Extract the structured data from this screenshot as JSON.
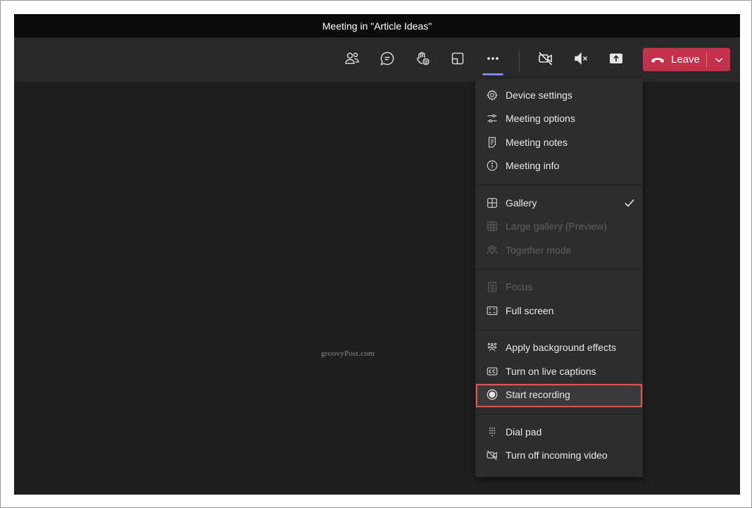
{
  "window": {
    "title": "Meeting in \"Article Ideas\""
  },
  "toolbar": {
    "buttons": [
      {
        "icon": "people-icon"
      },
      {
        "icon": "chat-icon"
      },
      {
        "icon": "reactions-icon"
      },
      {
        "icon": "rooms-icon"
      },
      {
        "icon": "more-options-icon"
      },
      {
        "icon": "camera-off-icon"
      },
      {
        "icon": "mic-mute-icon"
      },
      {
        "icon": "share-screen-icon"
      }
    ],
    "leave_label": "Leave",
    "leave_color": "#c4314b"
  },
  "stage": {
    "watermark": "groovyPost.com"
  },
  "menu": {
    "sections": [
      {
        "items": [
          {
            "label": "Device settings",
            "icon": "gear-icon",
            "enabled": true
          },
          {
            "label": "Meeting options",
            "icon": "sliders-icon",
            "enabled": true
          },
          {
            "label": "Meeting notes",
            "icon": "notes-icon",
            "enabled": true
          },
          {
            "label": "Meeting info",
            "icon": "info-icon",
            "enabled": true
          }
        ]
      },
      {
        "items": [
          {
            "label": "Gallery",
            "icon": "gallery-icon",
            "enabled": true,
            "checked": true
          },
          {
            "label": "Large gallery (Preview)",
            "icon": "large-gallery-icon",
            "enabled": false
          },
          {
            "label": "Together mode",
            "icon": "together-mode-icon",
            "enabled": false
          }
        ]
      },
      {
        "items": [
          {
            "label": "Focus",
            "icon": "focus-icon",
            "enabled": false
          },
          {
            "label": "Full screen",
            "icon": "full-screen-icon",
            "enabled": true
          }
        ]
      },
      {
        "items": [
          {
            "label": "Apply background effects",
            "icon": "background-effects-icon",
            "enabled": true
          },
          {
            "label": "Turn on live captions",
            "icon": "captions-icon",
            "enabled": true
          },
          {
            "label": "Start recording",
            "icon": "record-icon",
            "enabled": true,
            "highlighted": true
          }
        ]
      },
      {
        "items": [
          {
            "label": "Dial pad",
            "icon": "dial-pad-icon",
            "enabled": true
          },
          {
            "label": "Turn off incoming video",
            "icon": "video-off-icon",
            "enabled": true
          }
        ]
      }
    ],
    "highlight_color": "#e0564f"
  }
}
